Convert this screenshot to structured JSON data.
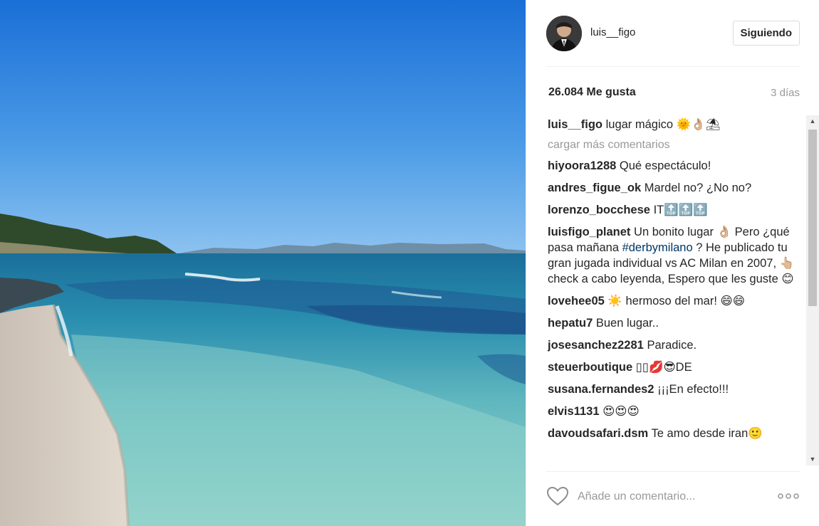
{
  "post": {
    "username": "luis__figo",
    "follow_label": "Siguiendo",
    "likes": "26.084 Me gusta",
    "time": "3 días"
  },
  "comments": {
    "caption": {
      "user": "luis__figo",
      "text": "lugar mágico 🌞👌🏼⛱"
    },
    "load_more": "cargar más comentarios",
    "items": [
      {
        "user": "hiyoora1288",
        "text": "Qué espectáculo!"
      },
      {
        "user": "andres_figue_ok",
        "text": "Mardel no? ¿No no?"
      },
      {
        "user": "lorenzo_bocchese",
        "text": "IT🔝🔝🔝"
      },
      {
        "user": "luisfigo_planet",
        "text_a": "Un bonito lugar 👌🏼 Pero ¿qué pasa mañana ",
        "hashtag": "#derbymilano",
        "text_b": " ? He publicado tu gran jugada individual vs AC Milan en 2007, 👆🏼check a cabo leyenda, Espero que les guste 😊"
      },
      {
        "user": "lovehee05",
        "text": "☀️ hermoso del mar! 😄😄"
      },
      {
        "user": "hepatu7",
        "text": "Buen lugar.."
      },
      {
        "user": "josesanchez2281",
        "text": "Paradice."
      },
      {
        "user": "steuerboutique",
        "text": "▯▯💋😎DE"
      },
      {
        "user": "susana.fernandes2",
        "text": "¡¡¡En efecto!!!"
      },
      {
        "user": "elvis1131",
        "text": "😍😍😍"
      },
      {
        "user": "davoudsafari.dsm",
        "text": "Te amo desde iran🙂"
      }
    ]
  },
  "footer": {
    "comment_placeholder": "Añade un comentario...",
    "more_glyph": "•••"
  },
  "scrollbar": {
    "up_glyph": "▲",
    "down_glyph": "▼"
  },
  "icons": {
    "like": "heart-icon",
    "more": "more-options-icon"
  },
  "colors": {
    "text": "#262626",
    "muted": "#999999",
    "hashtag": "#003569",
    "border": "#dbdbdb"
  }
}
